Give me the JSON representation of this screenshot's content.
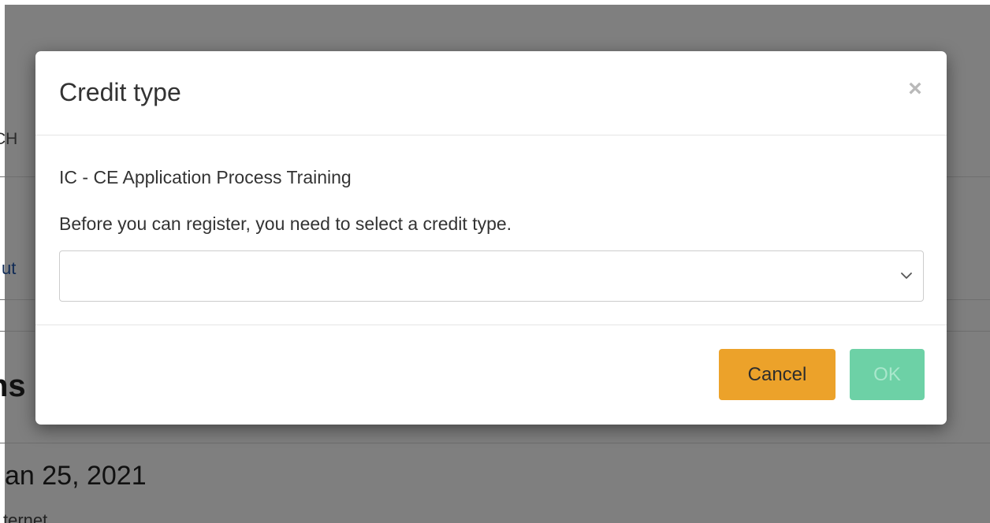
{
  "background": {
    "partial_text_1": "CH",
    "partial_link": "ut",
    "partial_heading": "ns",
    "partial_date": "an 25, 2021",
    "partial_text_2": "ternet"
  },
  "modal": {
    "title": "Credit type",
    "close_label": "×",
    "course_name": "IC - CE Application Process Training",
    "instruction": "Before you can register, you need to select a credit type.",
    "select": {
      "value": "",
      "icon": "chevron-down-icon"
    },
    "buttons": {
      "cancel_label": "Cancel",
      "ok_label": "OK"
    }
  },
  "colors": {
    "overlay": "#7f7f7f",
    "cancel_button": "#eca22a",
    "ok_button_disabled": "#6dd1a6"
  }
}
